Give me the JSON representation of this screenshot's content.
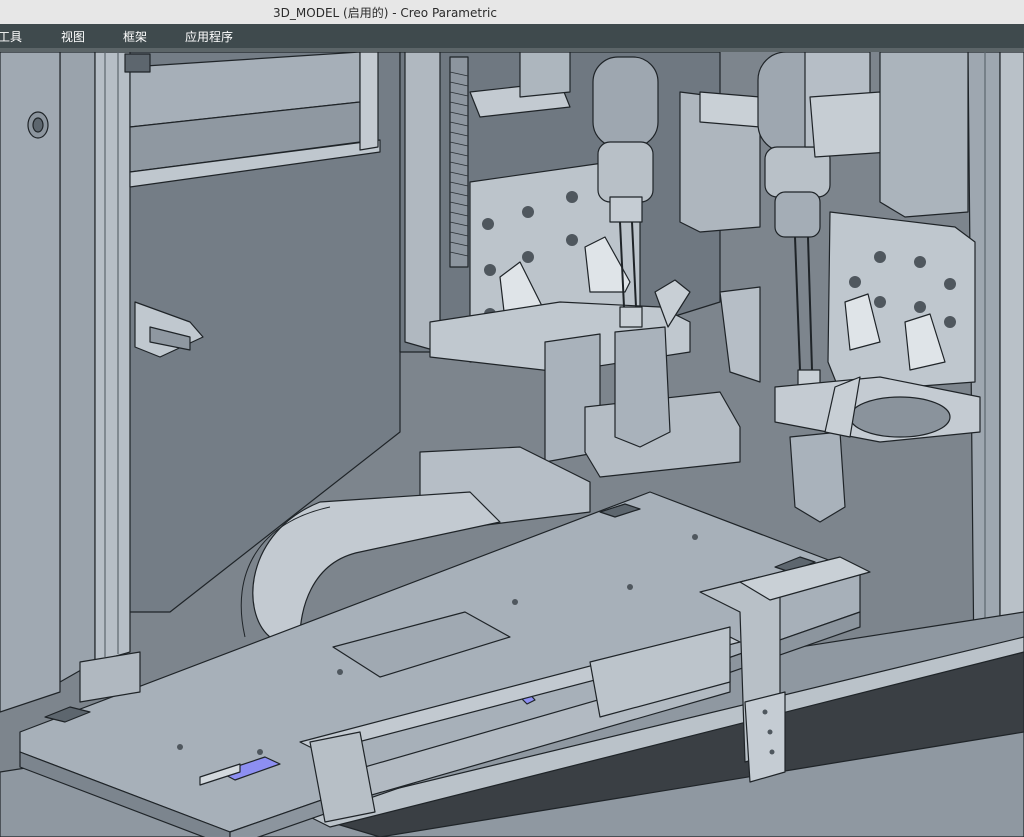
{
  "window": {
    "title": "3D_MODEL (启用的) - Creo Parametric"
  },
  "menu": {
    "items": [
      {
        "label": "工具"
      },
      {
        "label": "视图"
      },
      {
        "label": "框架"
      },
      {
        "label": "应用程序"
      }
    ]
  },
  "viewport": {
    "content": "cad-3d-model-render",
    "colors": {
      "background": "#7d858d",
      "part_fill": "#a7b0b9",
      "part_light": "#c3cad1",
      "part_dark": "#717b85",
      "edge": "#1f2428",
      "highlight": "#8d8ff2"
    }
  }
}
